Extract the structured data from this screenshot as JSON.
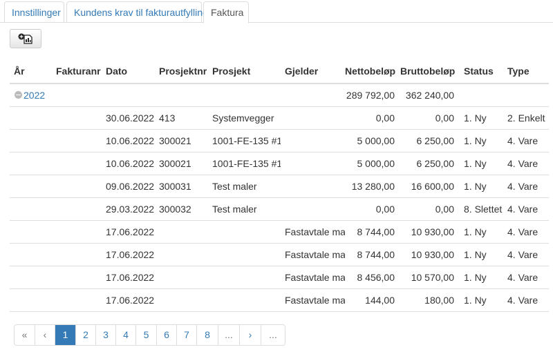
{
  "tabs": [
    {
      "label": "Innstillinger"
    },
    {
      "label": "Kundens krav til fakturautfylling"
    },
    {
      "label": "Faktura"
    }
  ],
  "toolbar": {
    "new_button_icon": "new-document-icon"
  },
  "table": {
    "headers": [
      "År",
      "Fakturanr",
      "Dato",
      "Prosjektnr",
      "Prosjekt",
      "Gjelder",
      "Nettobeløp",
      "Bruttobeløp",
      "Status",
      "Type"
    ],
    "group": {
      "year": "2022",
      "netto_total": "289 792,00",
      "brutto_total": "362 240,00"
    },
    "rows": [
      {
        "dato": "30.06.2022",
        "prosjektnr": "413",
        "prosjekt": "Systemvegger",
        "gjelder": "",
        "netto": "0,00",
        "brutto": "0,00",
        "status": "1. Ny",
        "type": "2. Enkelt"
      },
      {
        "dato": "10.06.2022",
        "prosjektnr": "300021",
        "prosjekt": "1001-FE-135 #1",
        "gjelder": "",
        "netto": "5 000,00",
        "brutto": "6 250,00",
        "status": "1. Ny",
        "type": "4. Vare"
      },
      {
        "dato": "10.06.2022",
        "prosjektnr": "300021",
        "prosjekt": "1001-FE-135 #1",
        "gjelder": "",
        "netto": "5 000,00",
        "brutto": "6 250,00",
        "status": "1. Ny",
        "type": "4. Vare"
      },
      {
        "dato": "09.06.2022",
        "prosjektnr": "300031",
        "prosjekt": "Test maler",
        "gjelder": "",
        "netto": "13 280,00",
        "brutto": "16 600,00",
        "status": "1. Ny",
        "type": "4. Vare"
      },
      {
        "dato": "29.03.2022",
        "prosjektnr": "300032",
        "prosjekt": "Test maler",
        "gjelder": "",
        "netto": "0,00",
        "brutto": "0,00",
        "status": "8. Slettet",
        "type": "4. Vare"
      },
      {
        "dato": "17.06.2022",
        "prosjektnr": "",
        "prosjekt": "",
        "gjelder": "Fastavtale mai",
        "netto": "8 744,00",
        "brutto": "10 930,00",
        "status": "1. Ny",
        "type": "4. Vare"
      },
      {
        "dato": "17.06.2022",
        "prosjektnr": "",
        "prosjekt": "",
        "gjelder": "Fastavtale mai",
        "netto": "8 744,00",
        "brutto": "10 930,00",
        "status": "1. Ny",
        "type": "4. Vare"
      },
      {
        "dato": "17.06.2022",
        "prosjektnr": "",
        "prosjekt": "",
        "gjelder": "Fastavtale mai",
        "netto": "8 456,00",
        "brutto": "10 570,00",
        "status": "1. Ny",
        "type": "4. Vare"
      },
      {
        "dato": "17.06.2022",
        "prosjektnr": "",
        "prosjekt": "",
        "gjelder": "Fastavtale mai",
        "netto": "144,00",
        "brutto": "180,00",
        "status": "1. Ny",
        "type": "4. Vare"
      }
    ]
  },
  "pagination": {
    "items": [
      "«",
      "‹",
      "1",
      "2",
      "3",
      "4",
      "5",
      "6",
      "7",
      "8",
      "...",
      "›",
      "..."
    ],
    "active": "1"
  },
  "colors": {
    "link": "#337ab7",
    "active_page": "#337ab7",
    "border": "#dddddd"
  }
}
